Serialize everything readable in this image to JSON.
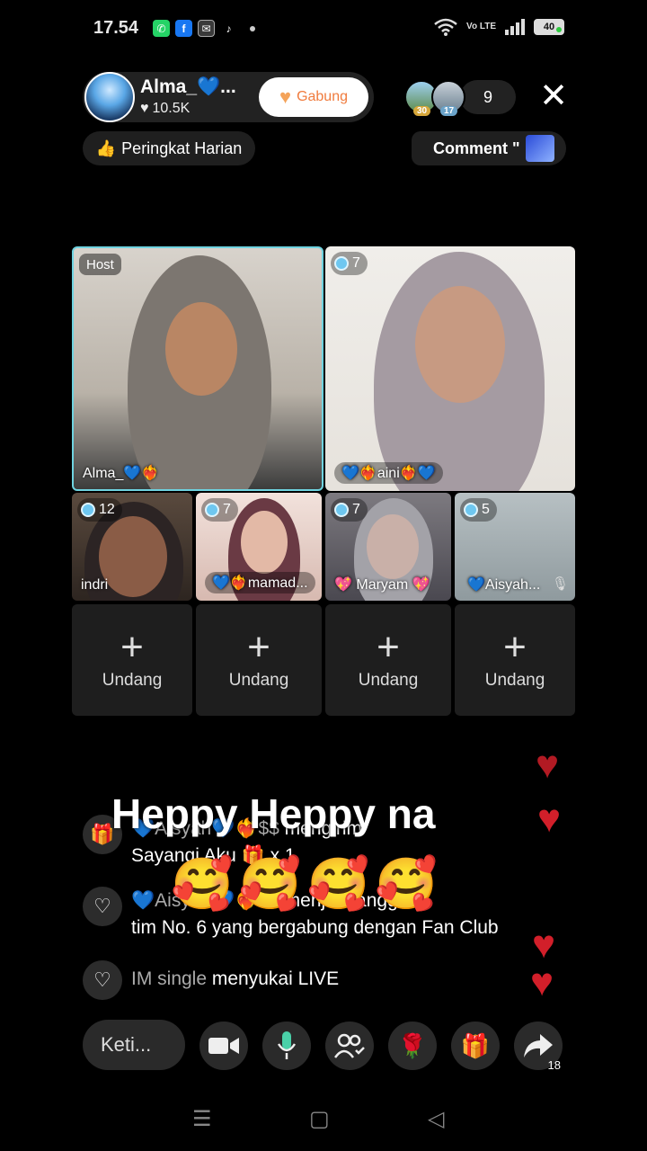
{
  "status_bar": {
    "time": "17.54",
    "apps": [
      "whatsapp-icon",
      "facebook-icon",
      "mail-icon",
      "tiktok-icon"
    ],
    "battery": "40",
    "network": "Vo LTE"
  },
  "host": {
    "name": "Alma_💙...",
    "likes": "10.5K",
    "join_label": "Gabung"
  },
  "viewers": {
    "badges": [
      "30",
      "17"
    ],
    "count": "9"
  },
  "daily_rank_label": "Peringkat Harian",
  "comment_label": "Comment \"",
  "main_tiles": [
    {
      "tag": "Host",
      "name": "Alma_💙❤️‍🔥"
    },
    {
      "tag": "7",
      "name": "💙❤️‍🔥aini❤️‍🔥💙"
    }
  ],
  "small_tiles": [
    {
      "tag": "12",
      "name": "indri"
    },
    {
      "tag": "7",
      "name": "💙❤️‍🔥mamad..."
    },
    {
      "tag": "7",
      "name": "💖 Maryam 💖"
    },
    {
      "tag": "5",
      "name": "💙Aisyah..."
    }
  ],
  "invite_slots": [
    "Undang",
    "Undang",
    "Undang",
    "Undang"
  ],
  "overlay_text": "Heppy Heppy na",
  "overlay_emojis": "🥰🥰🥰🥰",
  "chat": [
    {
      "line1_dim": "💙Aisyah💙❤️‍🔥$$",
      "line1": " mengirim",
      "line2": "Sayangi Aku 🎁 x 1"
    },
    {
      "line1_dim": "💙Aisyah💙❤️‍🔥$$",
      "line1": " menjadi anggota",
      "line2": "tim No. 6 yang bergabung dengan Fan Club"
    },
    {
      "line1_dim": "IM single",
      "line1": " menyukai LIVE"
    }
  ],
  "toolbar": {
    "type_placeholder": "Keti...",
    "share_count": "18"
  }
}
